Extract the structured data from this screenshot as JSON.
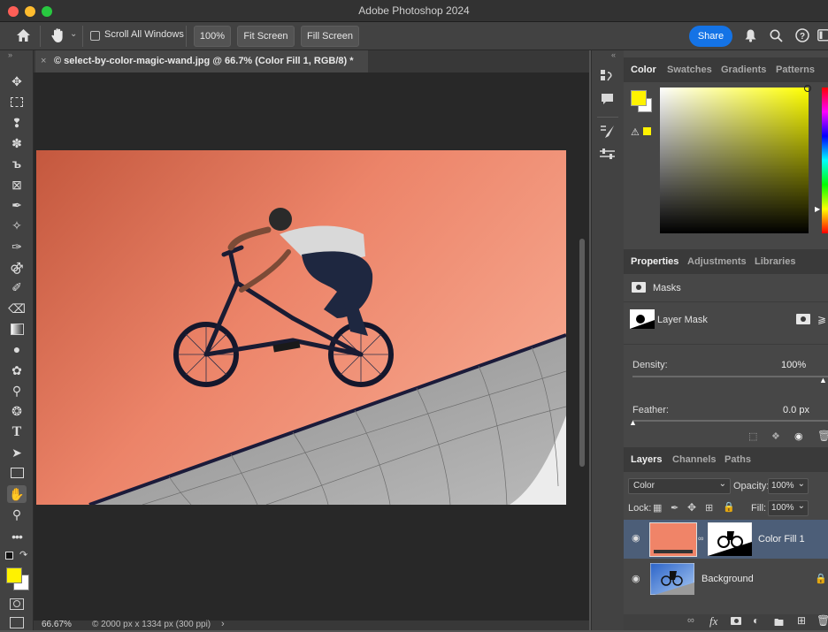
{
  "window": {
    "title": "Adobe Photoshop 2024"
  },
  "options_bar": {
    "scroll_all_label": "Scroll All Windows",
    "zoom_btn": "100%",
    "fit_screen": "Fit Screen",
    "fill_screen": "Fill Screen",
    "share": "Share"
  },
  "document": {
    "tab_title": "© select-by-color-magic-wand.jpg @ 66.7% (Color Fill 1, RGB/8) *",
    "close_glyph": "×",
    "zoom": "66.67%",
    "doc_info": "© 2000 px x 1334 px (300 ppi)",
    "status_arrow": "›"
  },
  "color_panel": {
    "tabs": [
      "Color",
      "Swatches",
      "Gradients",
      "Patterns"
    ],
    "active_tab": "Color",
    "foreground": "#fff200",
    "background": "#ffffff",
    "hue_field": "#ffff00"
  },
  "properties_panel": {
    "tabs": [
      "Properties",
      "Adjustments",
      "Libraries"
    ],
    "active_tab": "Properties",
    "section": "Masks",
    "mask_name": "Layer Mask",
    "density_label": "Density:",
    "density_value": "100%",
    "density_level": 1.0,
    "feather_label": "Feather:",
    "feather_value": "0.0 px",
    "feather_level": 0.0
  },
  "layers_panel": {
    "tabs": [
      "Layers",
      "Channels",
      "Paths"
    ],
    "active_tab": "Layers",
    "blend_mode": "Color",
    "opacity_label": "Opacity:",
    "opacity_value": "100%",
    "lock_label": "Lock:",
    "fill_label": "Fill:",
    "fill_value": "100%",
    "layers": [
      {
        "name": "Color Fill 1",
        "selected": true,
        "fill_color": "#f08468"
      },
      {
        "name": "Background",
        "selected": false,
        "locked": true
      }
    ],
    "footer_fx": "fx"
  },
  "tools": [
    "move-tool",
    "marquee-tool",
    "lasso-tool",
    "magic-wand-tool",
    "crop-tool",
    "frame-tool",
    "eyedropper-tool",
    "healing-brush-tool",
    "brush-tool",
    "clone-stamp-tool",
    "history-brush-tool",
    "eraser-tool",
    "gradient-tool",
    "blur-tool",
    "dodge-tool",
    "smudge-tool",
    "pen-tool",
    "type-tool",
    "path-selection-tool",
    "rectangle-tool",
    "hand-tool",
    "zoom-tool",
    "more-tools"
  ],
  "colors": {
    "accent": "#1473e6",
    "selected_layer": "#4c5e78",
    "overlay": "#f08468"
  }
}
